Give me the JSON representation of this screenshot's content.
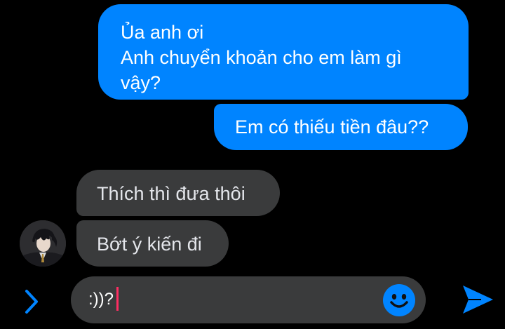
{
  "conversation": {
    "messages": [
      {
        "sender": "me",
        "lines": [
          "Ủa anh ơi",
          "Anh chuyển khoản cho em làm gì",
          "vậy?"
        ]
      },
      {
        "sender": "me",
        "lines": [
          "Em có thiếu tiền đâu??"
        ]
      },
      {
        "sender": "them",
        "lines": [
          "Thích thì đưa thôi"
        ]
      },
      {
        "sender": "them",
        "lines": [
          "Bớt ý kiến đi"
        ]
      }
    ]
  },
  "composer": {
    "value": ":))?",
    "expand_icon": "chevron-right-icon",
    "emoji_icon": "smiley-icon",
    "send_icon": "send-arrow-icon"
  },
  "contact": {
    "avatar_icon": "avatar-portrait"
  },
  "colors": {
    "background": "#000000",
    "sent_bubble": "#0084ff",
    "received_bubble": "#3a3b3c",
    "composer_bg": "#3a3b3c",
    "accent": "#0084ff",
    "caret": "#ff2e63"
  }
}
